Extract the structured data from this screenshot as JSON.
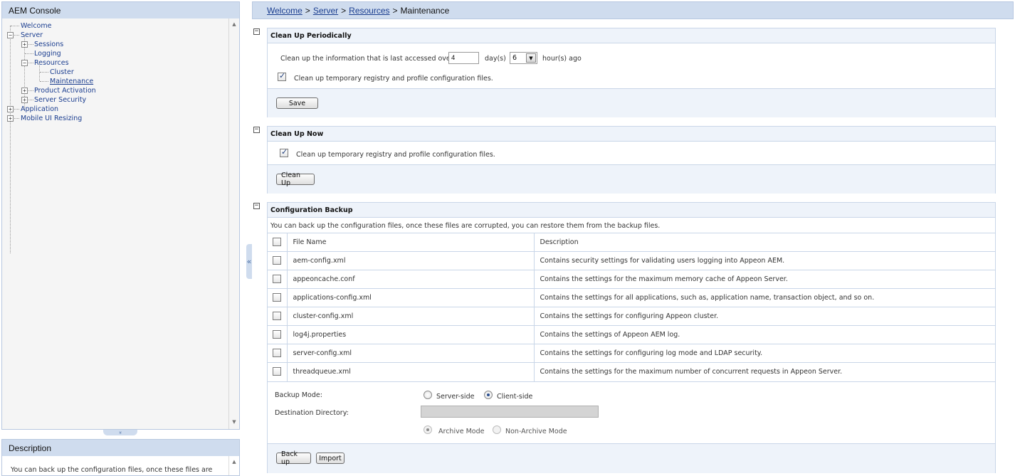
{
  "tree_panel": {
    "title": "AEM Console",
    "nodes": [
      {
        "label": "Welcome"
      },
      {
        "label": "Server",
        "expander": "−"
      },
      {
        "label": "Sessions",
        "expander": "+"
      },
      {
        "label": "Logging"
      },
      {
        "label": "Resources",
        "expander": "−"
      },
      {
        "label": "Cluster"
      },
      {
        "label": "Maintenance"
      },
      {
        "label": "Product Activation",
        "expander": "+"
      },
      {
        "label": "Server Security",
        "expander": "+"
      },
      {
        "label": "Application",
        "expander": "+"
      },
      {
        "label": "Mobile UI Resizing",
        "expander": "+"
      }
    ],
    "collapse_glyph": "»"
  },
  "description_panel": {
    "title": "Description",
    "text": "You can back up the configuration files, once these files are"
  },
  "splitter_glyph": "«",
  "breadcrumb": {
    "items": [
      "Welcome",
      "Server",
      "Resources"
    ],
    "separator": ">",
    "current": "Maintenance"
  },
  "section_toggle_glyph": "−",
  "cleanup_periodically": {
    "title": "Clean Up Periodically",
    "prompt": "Clean up the information that is last accessed over:",
    "days_value": "4",
    "days_unit": "day(s)",
    "hours_value": "6",
    "hours_unit": "hour(s) ago",
    "checkbox_label": "Clean up temporary registry and profile configuration files.",
    "checkbox_checked": true,
    "save_label": "Save"
  },
  "cleanup_now": {
    "title": "Clean Up Now",
    "checkbox_label": "Clean up temporary registry and profile configuration files.",
    "checkbox_checked": true,
    "button_label": "Clean Up"
  },
  "config_backup": {
    "title": "Configuration Backup",
    "intro": "You can back up the configuration files, once these files are corrupted, you can restore them from the backup files.",
    "columns": [
      "File Name",
      "Description"
    ],
    "rows": [
      {
        "file": "aem-config.xml",
        "description": "Contains security settings for validating users logging into Appeon AEM."
      },
      {
        "file": "appeoncache.conf",
        "description": "Contains the settings for the maximum memory cache of Appeon Server."
      },
      {
        "file": "applications-config.xml",
        "description": "Contains the settings for all applications, such as, application name, transaction object, and so on."
      },
      {
        "file": "cluster-config.xml",
        "description": "Contains the settings for configuring Appeon cluster."
      },
      {
        "file": "log4j.properties",
        "description": "Contains the settings of Appeon AEM log."
      },
      {
        "file": "server-config.xml",
        "description": "Contains the settings for configuring log mode and LDAP security."
      },
      {
        "file": "threadqueue.xml",
        "description": "Contains the settings for the maximum number of concurrent requests in Appeon Server."
      }
    ],
    "backup_mode_label": "Backup Mode:",
    "backup_mode_options": [
      "Server-side",
      "Client-side"
    ],
    "backup_mode_selected": "Client-side",
    "destination_label": "Destination Directory:",
    "destination_value": "",
    "archive_options": [
      "Archive Mode",
      "Non-Archive Mode"
    ],
    "archive_selected": "Archive Mode",
    "backup_button": "Back up",
    "import_button": "Import"
  },
  "colors": {
    "header_bg": "#cfdcee",
    "section_title_bg": "#eef3fa",
    "link": "#1a3d8f",
    "border": "#c9d6e8"
  }
}
